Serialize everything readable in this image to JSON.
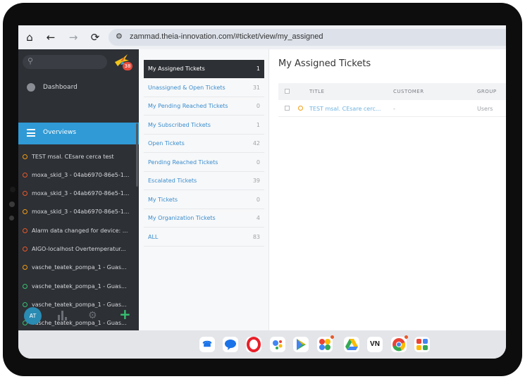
{
  "browser": {
    "url": "zammad.theia-innovation.com/#ticket/view/my_assigned"
  },
  "sidebar": {
    "notification_badge": "38",
    "menu": [
      {
        "label": "Dashboard"
      },
      {
        "label": "Overviews"
      }
    ],
    "tickets": [
      {
        "label": "TEST msal. CEsare cerca test",
        "status": "orange"
      },
      {
        "label": "moxa_skid_3 - 04ab6970-86e5-1...",
        "status": "red"
      },
      {
        "label": "moxa_skid_3 - 04ab6970-86e5-1...",
        "status": "red"
      },
      {
        "label": "moxa_skid_3 - 04ab6970-86e5-1...",
        "status": "orange"
      },
      {
        "label": "Alarm data changed for device: ...",
        "status": "red"
      },
      {
        "label": "AIGO-localhost Overtemperatur...",
        "status": "red"
      },
      {
        "label": "vasche_teatek_pompa_1 - Guas...",
        "status": "orange"
      },
      {
        "label": "vasche_teatek_pompa_1 - Guas...",
        "status": "green"
      },
      {
        "label": "vasche_teatek_pompa_1 - Guas...",
        "status": "green"
      },
      {
        "label": "vasche_teatek_pompa_1 - Guas...",
        "status": "green"
      }
    ],
    "avatar_initials": "AT"
  },
  "overviews": [
    {
      "label": "My Assigned Tickets",
      "count": "1"
    },
    {
      "label": "Unassigned & Open Tickets",
      "count": "31"
    },
    {
      "label": "My Pending Reached Tickets",
      "count": "0"
    },
    {
      "label": "My Subscribed Tickets",
      "count": "1"
    },
    {
      "label": "Open Tickets",
      "count": "42"
    },
    {
      "label": "Pending Reached Tickets",
      "count": "0"
    },
    {
      "label": "Escalated Tickets",
      "count": "39"
    },
    {
      "label": "My Tickets",
      "count": "0"
    },
    {
      "label": "My Organization Tickets",
      "count": "4"
    },
    {
      "label": "ALL",
      "count": "83"
    }
  ],
  "main": {
    "title": "My Assigned Tickets",
    "columns": [
      "TITLE",
      "CUSTOMER",
      "GROUP"
    ],
    "rows": [
      {
        "title": "TEST msal. CEsare cerc...",
        "customer": "-",
        "group": "Users"
      }
    ]
  },
  "dock": {
    "apps": [
      "phone-app",
      "messages-app",
      "opera-app",
      "assistant-app",
      "play-store-app",
      "photos-app",
      "drive-app",
      "vn-app",
      "chrome-app",
      "launcher-app"
    ],
    "vn_label": "VN",
    "colors": {
      "accent": "#2f9ad6",
      "sidebar": "#2d3035",
      "link": "#3a8ccd"
    }
  }
}
